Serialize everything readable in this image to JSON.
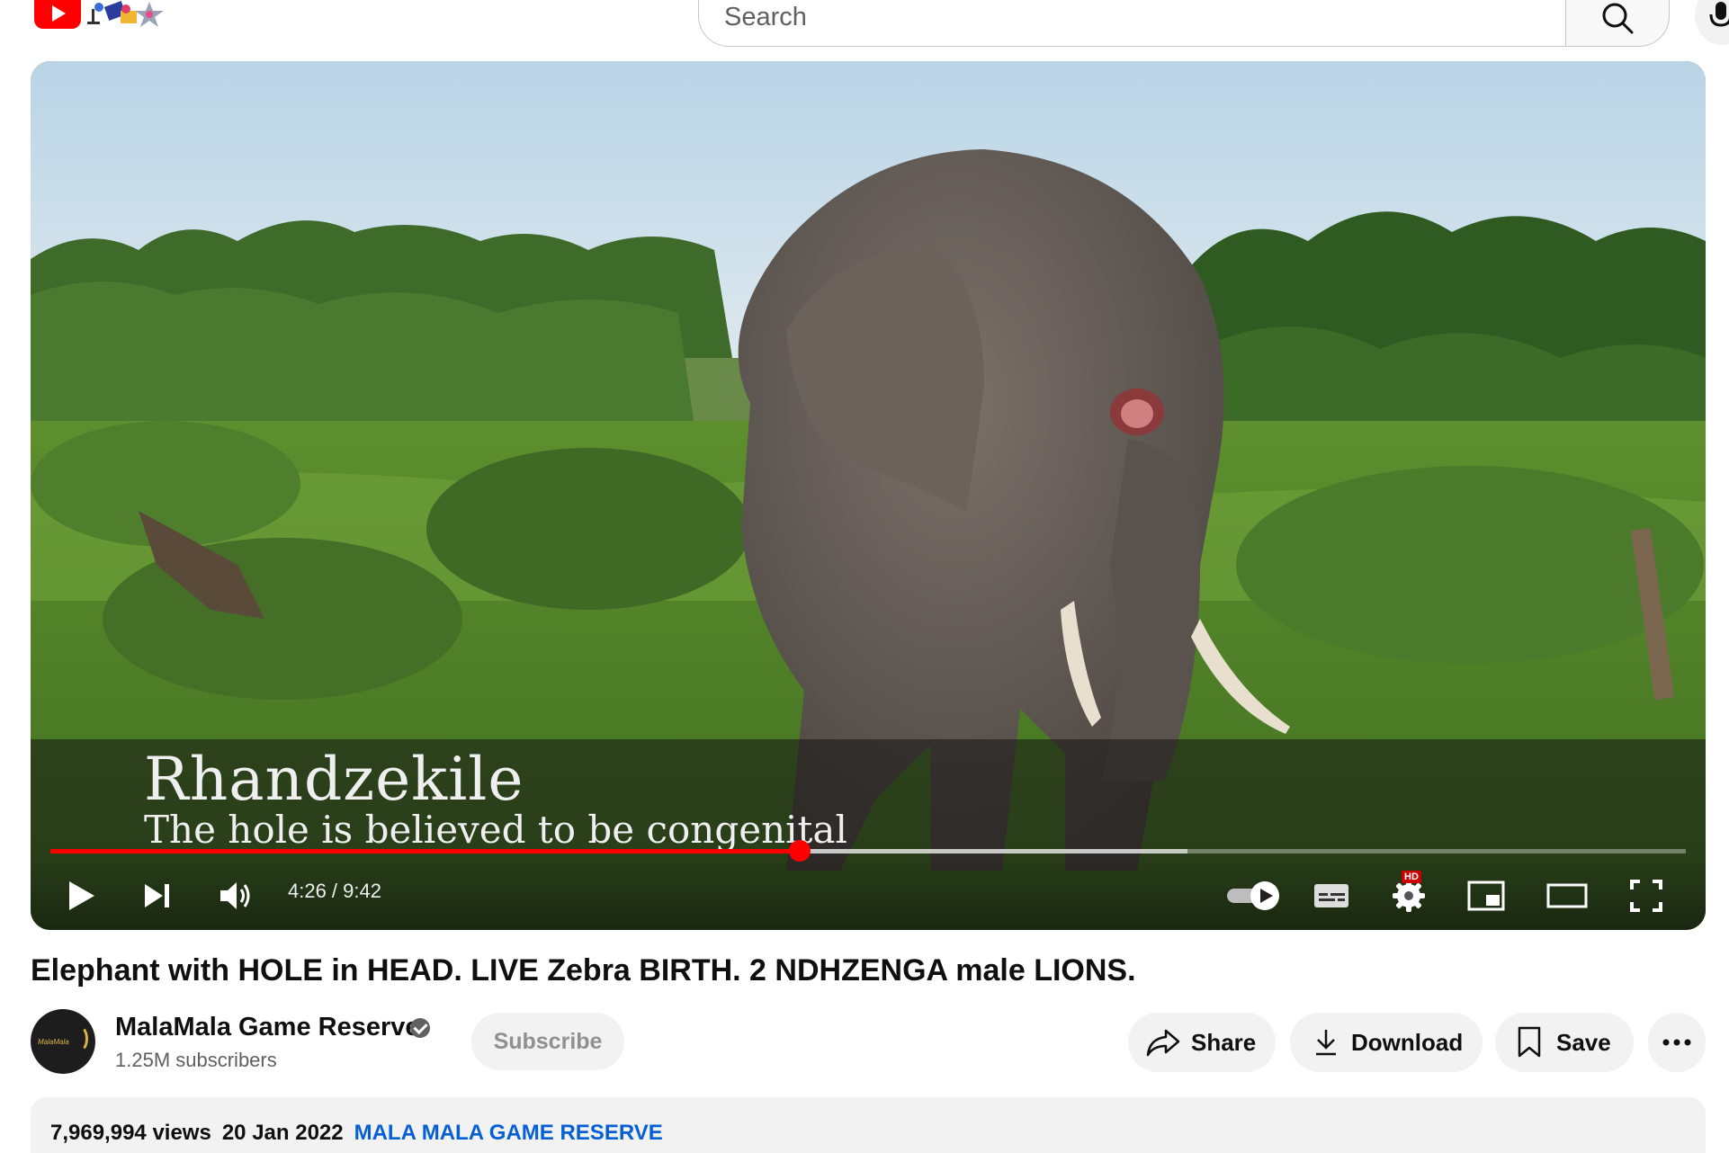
{
  "header": {
    "search_placeholder": "Search"
  },
  "player": {
    "caption_name": "Rhandzekile",
    "caption_subtitle": "The hole is believed to be congenital",
    "current_time": "4:26",
    "duration": "9:42",
    "time_display": "4:26 / 9:42",
    "progress_played": 0.458,
    "progress_buffered": 0.695,
    "quality_badge": "HD",
    "accent_color": "#ff0000"
  },
  "video": {
    "title": "Elephant with HOLE in HEAD. LIVE Zebra BIRTH. 2 NDHZENGA male LIONS."
  },
  "channel": {
    "name": "MalaMala Game Reserve",
    "subscribers": "1.25M subscribers",
    "avatar_text": "MalaMala",
    "subscribe_label": "Subscribe"
  },
  "actions": {
    "share_label": "Share",
    "download_label": "Download",
    "save_label": "Save"
  },
  "description": {
    "views": "7,969,994 views",
    "date": "20 Jan 2022",
    "hashtag": "MALA MALA GAME RESERVE",
    "hashtag_color": "#065fd4"
  },
  "icons": [
    "youtube-logo-icon",
    "search-icon",
    "mic-icon",
    "play-icon",
    "next-icon",
    "volume-icon",
    "autoplay-toggle-icon",
    "subtitles-icon",
    "settings-icon",
    "miniplayer-icon",
    "theater-mode-icon",
    "fullscreen-icon",
    "verified-icon",
    "share-icon",
    "download-icon",
    "save-icon",
    "more-icon"
  ]
}
